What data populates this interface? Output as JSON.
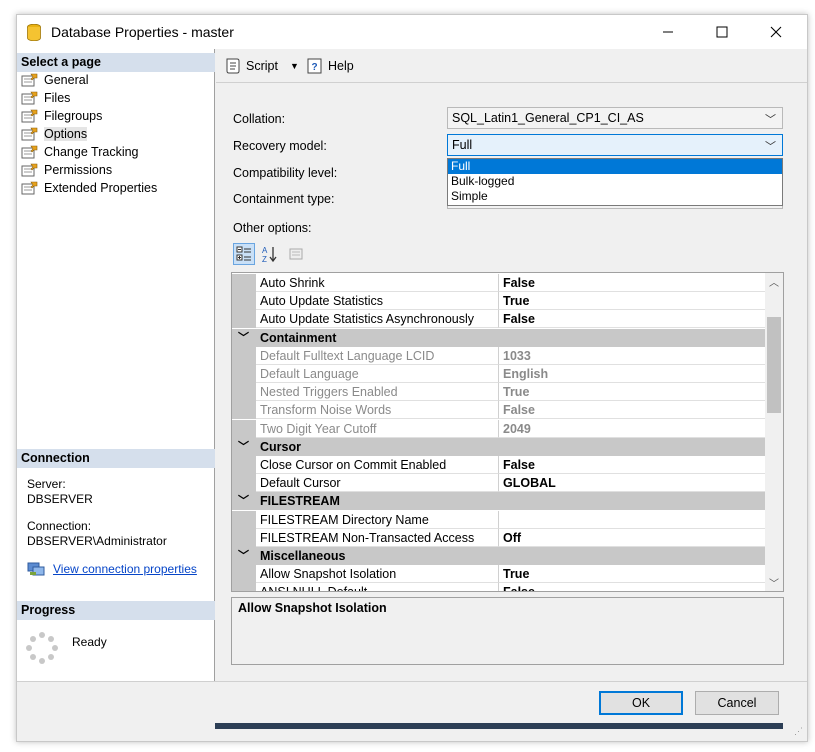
{
  "window": {
    "title": "Database Properties - master"
  },
  "left": {
    "select_page_header": "Select a page",
    "pages": [
      {
        "label": "General",
        "name": "page-general",
        "selected": false
      },
      {
        "label": "Files",
        "name": "page-files",
        "selected": false
      },
      {
        "label": "Filegroups",
        "name": "page-filegroups",
        "selected": false
      },
      {
        "label": "Options",
        "name": "page-options",
        "selected": true
      },
      {
        "label": "Change Tracking",
        "name": "page-change-tracking",
        "selected": false
      },
      {
        "label": "Permissions",
        "name": "page-permissions",
        "selected": false
      },
      {
        "label": "Extended Properties",
        "name": "page-extended-properties",
        "selected": false
      }
    ],
    "connection_header": "Connection",
    "server_label": "Server:",
    "server_value": "DBSERVER",
    "connection_label": "Connection:",
    "connection_value": "DBSERVER\\Administrator",
    "view_connection_link": "View connection properties",
    "progress_header": "Progress",
    "progress_status": "Ready"
  },
  "toolbar": {
    "script_label": "Script",
    "help_label": "Help"
  },
  "form": {
    "collation_label": "Collation:",
    "collation_value": "SQL_Latin1_General_CP1_CI_AS",
    "recovery_label": "Recovery model:",
    "recovery_value": "Full",
    "recovery_options": [
      "Full",
      "Bulk-logged",
      "Simple"
    ],
    "compat_label": "Compatibility level:",
    "containment_label": "Containment type:",
    "other_options_label": "Other options:"
  },
  "grid": {
    "rows": [
      {
        "kind": "prop",
        "name": "Auto Shrink",
        "value": "False",
        "dim": false
      },
      {
        "kind": "prop",
        "name": "Auto Update Statistics",
        "value": "True",
        "dim": false
      },
      {
        "kind": "prop",
        "name": "Auto Update Statistics Asynchronously",
        "value": "False",
        "dim": false
      },
      {
        "kind": "cat",
        "name": "Containment"
      },
      {
        "kind": "prop",
        "name": "Default Fulltext Language LCID",
        "value": "1033",
        "dim": true
      },
      {
        "kind": "prop",
        "name": "Default Language",
        "value": "English",
        "dim": true
      },
      {
        "kind": "prop",
        "name": "Nested Triggers Enabled",
        "value": "True",
        "dim": true
      },
      {
        "kind": "prop",
        "name": "Transform Noise Words",
        "value": "False",
        "dim": true
      },
      {
        "kind": "prop",
        "name": "Two Digit Year Cutoff",
        "value": "2049",
        "dim": true
      },
      {
        "kind": "cat",
        "name": "Cursor"
      },
      {
        "kind": "prop",
        "name": "Close Cursor on Commit Enabled",
        "value": "False",
        "dim": false
      },
      {
        "kind": "prop",
        "name": "Default Cursor",
        "value": "GLOBAL",
        "dim": false
      },
      {
        "kind": "cat",
        "name": "FILESTREAM"
      },
      {
        "kind": "prop",
        "name": "FILESTREAM Directory Name",
        "value": "",
        "dim": false
      },
      {
        "kind": "prop",
        "name": "FILESTREAM Non-Transacted Access",
        "value": "Off",
        "dim": false
      },
      {
        "kind": "cat",
        "name": "Miscellaneous"
      },
      {
        "kind": "prop",
        "name": "Allow Snapshot Isolation",
        "value": "True",
        "dim": false
      },
      {
        "kind": "prop",
        "name": "ANSI NULL Default",
        "value": "False",
        "dim": false
      }
    ],
    "description_title": "Allow Snapshot Isolation"
  },
  "buttons": {
    "ok": "OK",
    "cancel": "Cancel"
  },
  "colors": {
    "accent": "#0078d7",
    "section_header": "#d5dfec",
    "category_row": "#c8c8c8"
  }
}
